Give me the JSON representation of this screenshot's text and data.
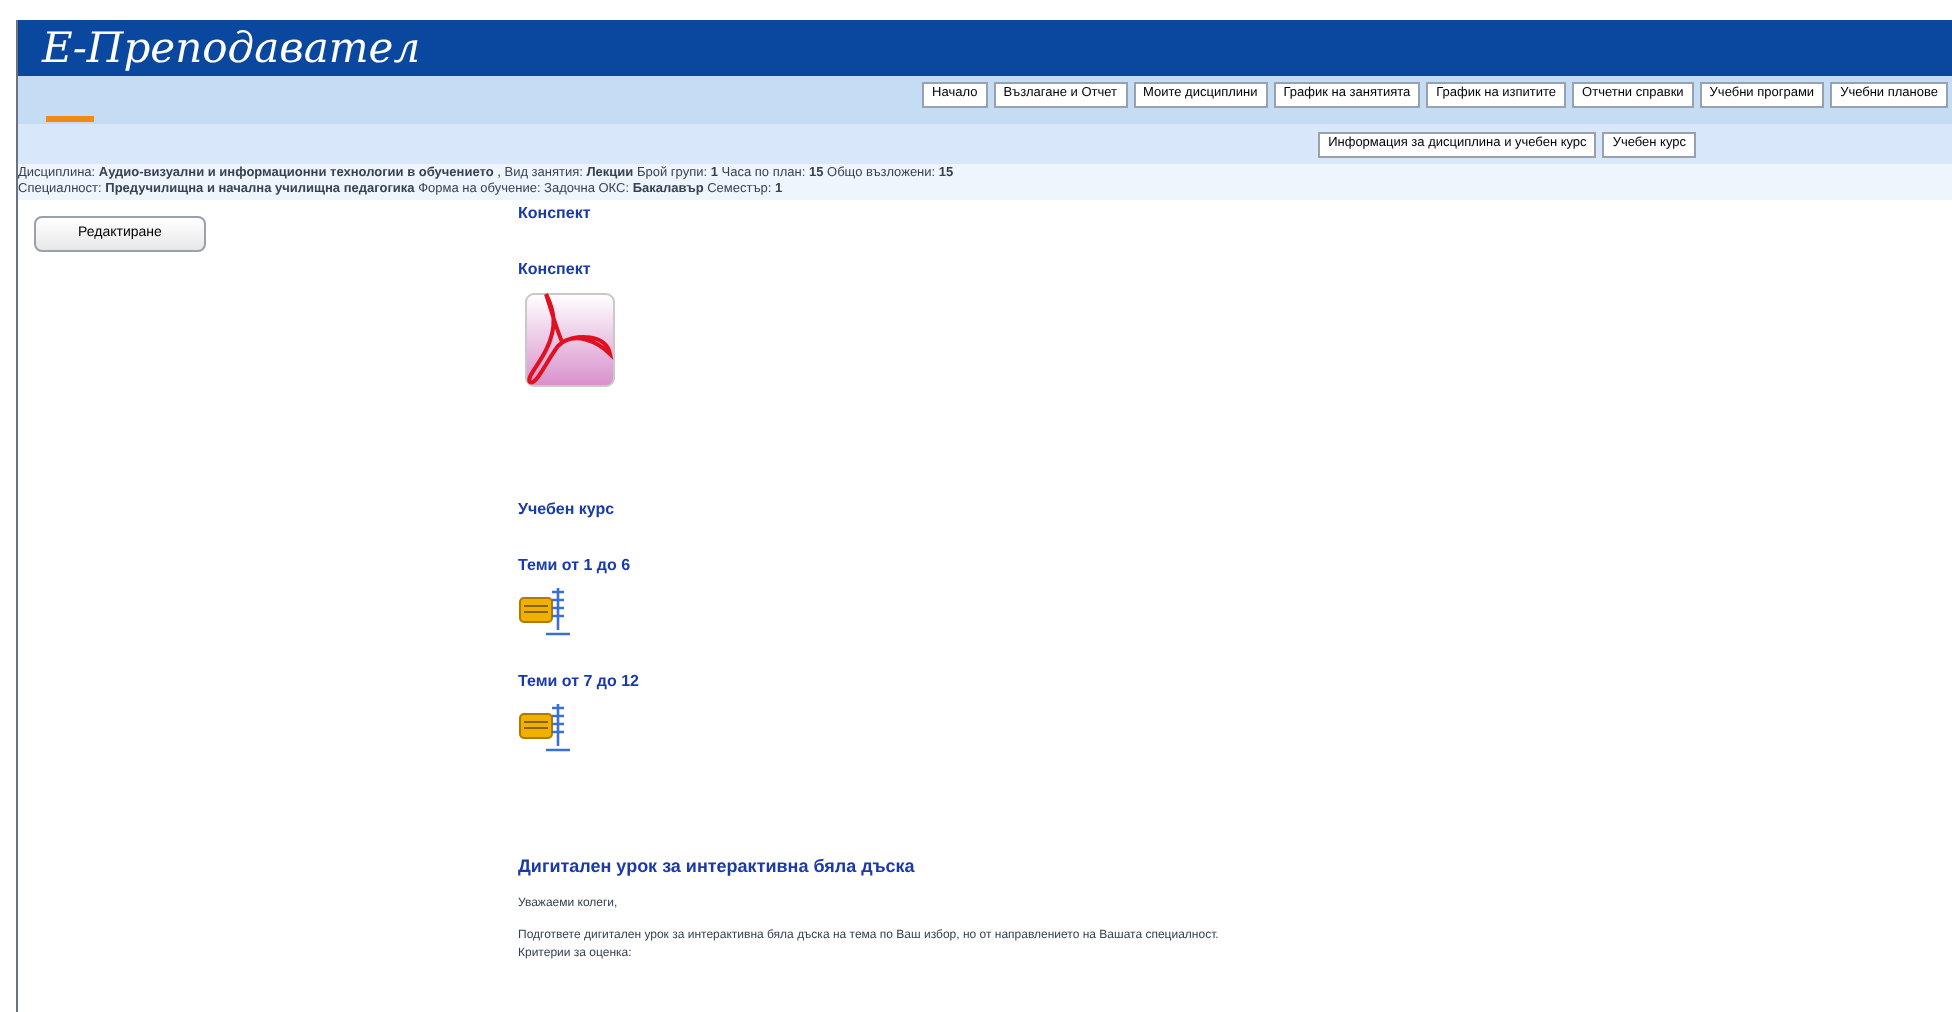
{
  "header": {
    "logo": "Е-Преподавател"
  },
  "nav": [
    {
      "label": "Начало"
    },
    {
      "label": "Възлагане и Отчет"
    },
    {
      "label": "Моите дисциплини"
    },
    {
      "label": "График на занятията"
    },
    {
      "label": "График на изпитите"
    },
    {
      "label": "Отчетни справки"
    },
    {
      "label": "Учебни програми"
    },
    {
      "label": "Учебни планове"
    }
  ],
  "subnav": [
    {
      "label": "Информация за дисциплина и учебен курс"
    },
    {
      "label": "Учебен курс"
    }
  ],
  "info_lines": [
    "Дисциплина: **Аудио-визуални и информационни технологии в обучението** , Вид занятия: **Лекции** Брой групи: **1** Часа по план: **15** Общо възложени: **15**",
    "Специалност: **Предучилищна и начална училищна педагогика** Форма на обучение: Задочна ОКС: **Бакалавър** Семестър: **1**"
  ],
  "edit_button": "Редактиране",
  "blocks": [
    {
      "kind": "section",
      "text": "Конспект"
    },
    {
      "kind": "pdf_resource",
      "text": "Конспект"
    },
    {
      "kind": "section",
      "text": "Учебен курс"
    },
    {
      "kind": "archive_resource",
      "text": "Теми от 1 до 6"
    },
    {
      "kind": "archive_resource",
      "text": "Теми от 7 до 12"
    },
    {
      "kind": "heading",
      "text": "Дигитален урок за интерактивна бяла дъска"
    },
    {
      "kind": "paragraph",
      "text": "Уважаеми колеги,"
    },
    {
      "kind": "paragraph",
      "text": "Подгответе дигитален урок за интерактивна бяла дъска на тема по Ваш избор, но от направлението на Вашата специалност."
    },
    {
      "kind": "line",
      "text": "Критерии за оценка:"
    }
  ]
}
